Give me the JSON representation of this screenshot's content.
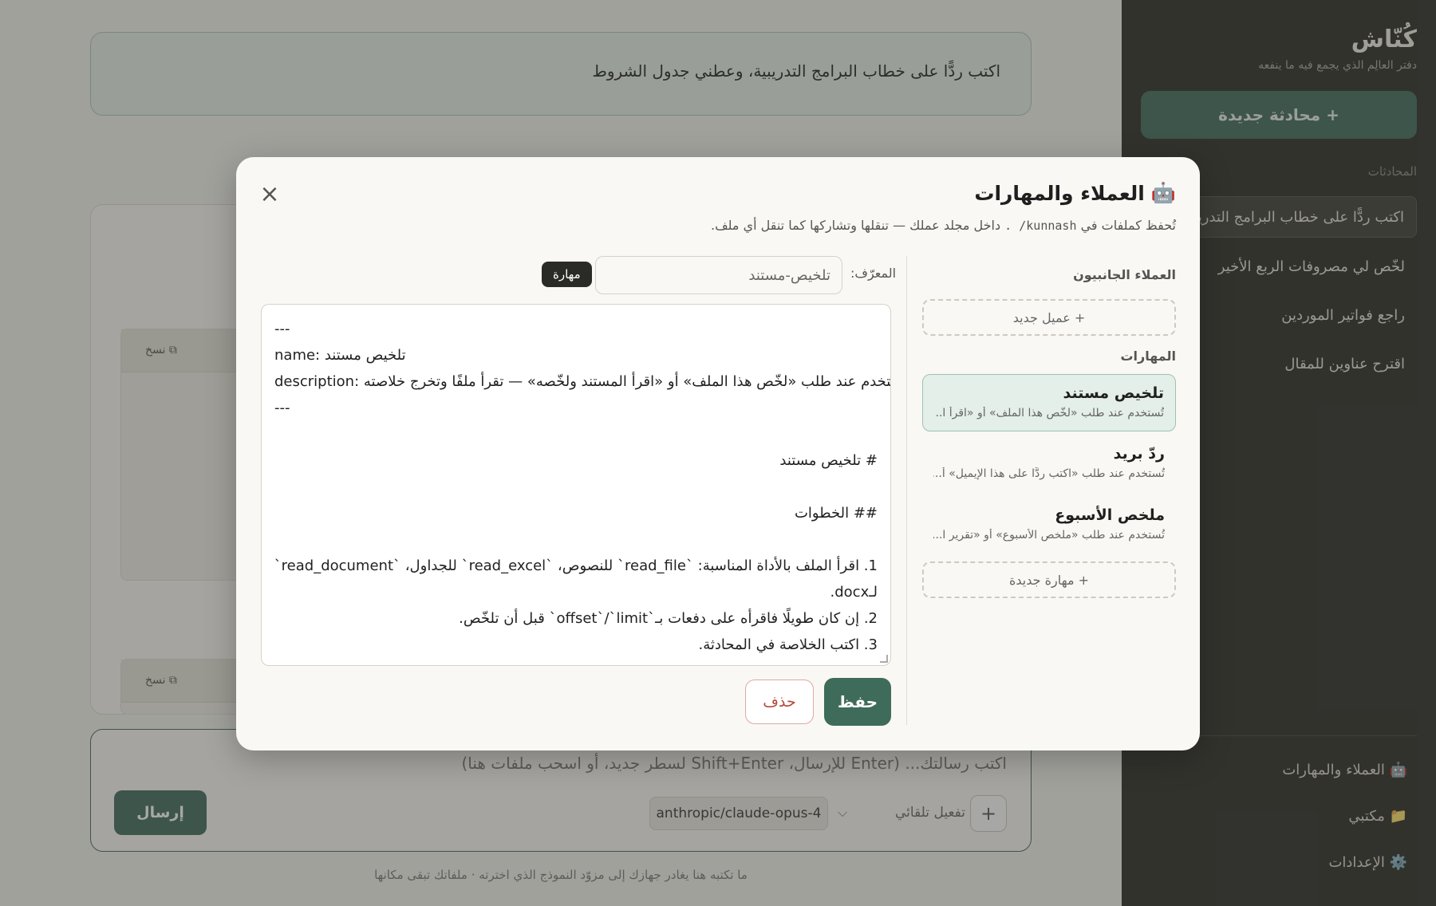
{
  "sidebar": {
    "brand": "كُنّاش",
    "tagline": "دفتر العالِم الذي يجمع فيه ما ينفعه",
    "new_chat": "+ محادثة جديدة",
    "section_label": "المحادثات",
    "conversations": [
      "اكتب ردًّا على خطاب البرامج التدريبية",
      "لخّص لي مصروفات الربع الأخير",
      "راجع فواتير الموردين",
      "اقترح عناوين للمقال"
    ],
    "footer": {
      "agents": "🤖 العملاء والمهارات",
      "library": "📁 مكتبي",
      "settings": "⚙️ الإعدادات"
    }
  },
  "main": {
    "prompt_bubble": "اكتب ردًّا على خطاب البرامج التدريبية، وعطني جدول الشروط",
    "copy_label": "⧉ نسخ",
    "composer": {
      "placeholder": "اكتب رسالتك... (Enter للإرسال، Shift+Enter لسطر جديد، أو اسحب ملفات هنا)",
      "send": "إرسال",
      "model": "anthropic/claude-opus-4",
      "auto_label": "تفعيل تلقائي",
      "plus": "+"
    },
    "privacy_note": "ما تكتبه هنا يغادر جهازك إلى مزوّد النموذج الذي اخترته · ملفاتك تبقى مكانها"
  },
  "modal": {
    "icon": "🤖",
    "title": "العملاء والمهارات",
    "subtitle_pre": "تُحفظ كملفات في",
    "subtitle_path": "kunnash/ .",
    "subtitle_post": "داخل مجلد عملك — تنقلها وتشاركها كما تنقل أي ملف.",
    "close": "×",
    "side_agents_label": "العملاء الجانبيون",
    "new_agent": "+ عميل جديد",
    "skills_label": "المهارات",
    "skills": [
      {
        "name": "تلخيص مستند",
        "desc": "تُستخدم عند طلب «لخّص هذا الملف» أو «اقرأ ا..."
      },
      {
        "name": "ردّ بريد",
        "desc": "تُستخدم عند طلب «اكتب ردًّا على هذا الإيميل» أ..."
      },
      {
        "name": "ملخص الأسبوع",
        "desc": "تُستخدم عند طلب «ملخص الأسبوع» أو «تقرير ا..."
      }
    ],
    "new_skill": "+ مهارة جديدة",
    "id_label": "المعرّف:",
    "id_value": "تلخيص-مستند",
    "badge": "مهارة",
    "editor_lines": [
      {
        "text": "---",
        "dir": "ltr"
      },
      {
        "text": "name: تلخيص مستند",
        "dir": "ltr"
      },
      {
        "text": "description: تُستخدم عند طلب «لخّص هذا الملف» أو «اقرأ المستند ولخّصه» — تقرأ ملفًا وتخرج خلاصته.",
        "dir": "ltr"
      },
      {
        "text": "---",
        "dir": "ltr"
      },
      {
        "text": "",
        "dir": "ltr"
      },
      {
        "text": "# تلخيص مستند",
        "dir": "rtl"
      },
      {
        "text": "",
        "dir": "ltr"
      },
      {
        "text": "## الخطوات",
        "dir": "rtl"
      },
      {
        "text": "",
        "dir": "ltr"
      },
      {
        "text": "1. اقرأ الملف بالأداة المناسبة: `read_file` للنصوص، `read_excel` للجداول، `read_document`",
        "dir": "rtl"
      },
      {
        "text": "لـdocx.",
        "dir": "rtl"
      },
      {
        "text": "2. إن كان طويلًا فاقرأه على دفعات بـ`offset`/`limit` قبل أن تلخّص.",
        "dir": "rtl"
      },
      {
        "text": "3. اكتب الخلاصة في المحادثة.",
        "dir": "rtl"
      }
    ],
    "save": "حفظ",
    "delete": "حذف"
  }
}
